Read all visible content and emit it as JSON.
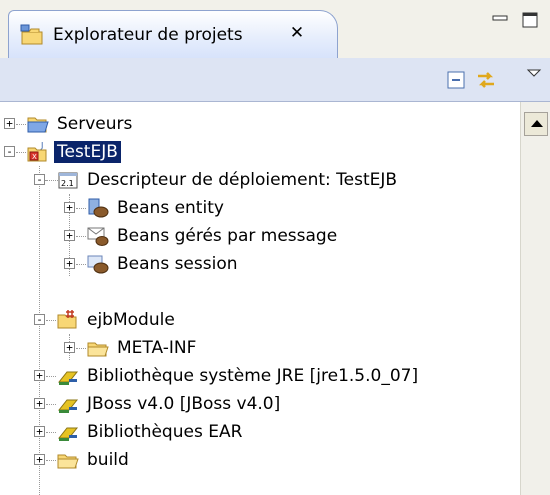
{
  "view": {
    "title": "Explorateur de projets",
    "close_symbol": "✕"
  },
  "icons": {
    "tab": "project-explorer-icon",
    "minimize": "minimize-icon",
    "maximize": "maximize-icon",
    "collapse_all": "collapse-all-icon",
    "link_editor": "link-with-editor-icon",
    "view_menu": "view-menu-icon"
  },
  "colors": {
    "selection": "#0a246a",
    "toolbar": "#dde4f3"
  },
  "tree": [
    {
      "label": "Serveurs",
      "icon": "folder-icon",
      "expander": "+"
    },
    {
      "label": "TestEJB",
      "icon": "ejb-project-icon",
      "expander": "-",
      "selected": true
    },
    {
      "label": "Descripteur de déploiement: TestEJB",
      "icon": "deployment-descriptor-icon",
      "expander": "-"
    },
    {
      "label": "Beans entity",
      "icon": "entity-bean-icon",
      "expander": "+"
    },
    {
      "label": "Beans gérés par message",
      "icon": "message-bean-icon",
      "expander": "+"
    },
    {
      "label": "Beans session",
      "icon": "session-bean-icon",
      "expander": "+"
    },
    {
      "label": "ejbModule",
      "icon": "source-folder-icon",
      "expander": "-"
    },
    {
      "label": "META-INF",
      "icon": "folder-icon",
      "expander": "+"
    },
    {
      "label": "Bibliothèque système JRE [jre1.5.0_07]",
      "icon": "library-icon",
      "expander": "+"
    },
    {
      "label": "JBoss v4.0 [JBoss v4.0]",
      "icon": "library-icon",
      "expander": "+"
    },
    {
      "label": "Bibliothèques EAR",
      "icon": "library-icon",
      "expander": "+"
    },
    {
      "label": "build",
      "icon": "folder-icon",
      "expander": "+"
    }
  ]
}
